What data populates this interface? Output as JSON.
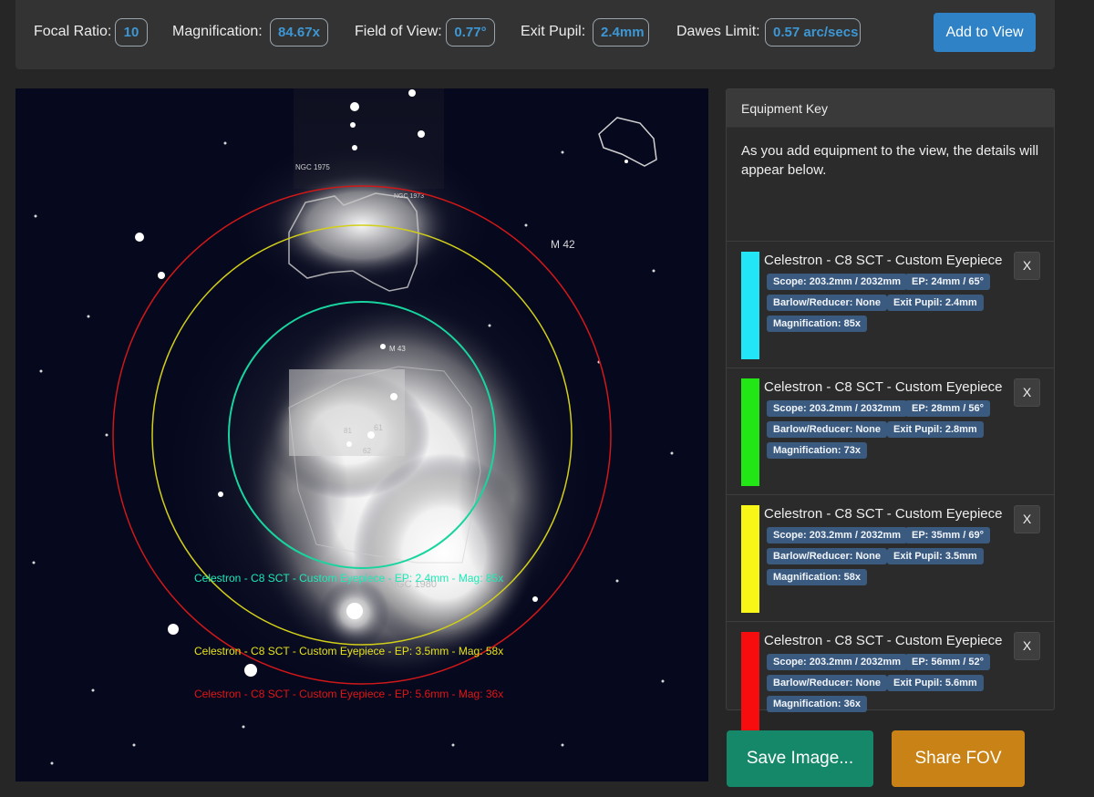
{
  "stats": [
    {
      "label": "Focal Ratio:",
      "value": "10"
    },
    {
      "label": "Magnification:",
      "value": "84.67x"
    },
    {
      "label": "Field of View:",
      "value": "0.77°"
    },
    {
      "label": "Exit Pupil:",
      "value": "2.4mm"
    },
    {
      "label": "Dawes Limit:",
      "value": "0.57 arc/secs"
    }
  ],
  "add_button": "Add to View",
  "sky": {
    "labels": {
      "ngc1975": "NGC 1975",
      "ngc1973": "NGC 1973",
      "m42": "M 42",
      "m43": "M 43",
      "ngc1980": "NGC 1980",
      "star61": "61",
      "star62": "62",
      "star81": "81"
    },
    "fov_captions": [
      {
        "text": "Celestron - C8 SCT - Custom Eyepiece - EP: 2.4mm - Mag: 85x",
        "color": "#1de9b6"
      },
      {
        "text": "Celestron - C8 SCT - Custom Eyepiece - EP: 3.5mm - Mag: 58x",
        "color": "#e6e21a"
      },
      {
        "text": "Celestron - C8 SCT - Custom Eyepiece - EP: 5.6mm - Mag: 36x",
        "color": "#e01515"
      }
    ]
  },
  "panel": {
    "title": "Equipment Key",
    "description": "As you add equipment to the view, the details will appear below.",
    "items": [
      {
        "color": "#22e6f7",
        "title": "Celestron - C8 SCT - Custom Eyepiece",
        "scope": "Scope: 203.2mm / 2032mm",
        "ep": "EP: 24mm / 65°",
        "barlow": "Barlow/Reducer: None",
        "exit_pupil": "Exit Pupil: 2.4mm",
        "magnification": "Magnification: 85x",
        "close": "X"
      },
      {
        "color": "#22e616",
        "title": "Celestron - C8 SCT - Custom Eyepiece",
        "scope": "Scope: 203.2mm / 2032mm",
        "ep": "EP: 28mm / 56°",
        "barlow": "Barlow/Reducer: None",
        "exit_pupil": "Exit Pupil: 2.8mm",
        "magnification": "Magnification: 73x",
        "close": "X"
      },
      {
        "color": "#f7f616",
        "title": "Celestron - C8 SCT - Custom Eyepiece",
        "scope": "Scope: 203.2mm / 2032mm",
        "ep": "EP: 35mm / 69°",
        "barlow": "Barlow/Reducer: None",
        "exit_pupil": "Exit Pupil: 3.5mm",
        "magnification": "Magnification: 58x",
        "close": "X"
      },
      {
        "color": "#f70d0d",
        "title": "Celestron - C8 SCT - Custom Eyepiece",
        "scope": "Scope: 203.2mm / 2032mm",
        "ep": "EP: 56mm / 52°",
        "barlow": "Barlow/Reducer: None",
        "exit_pupil": "Exit Pupil: 5.6mm",
        "magnification": "Magnification: 36x",
        "close": "X"
      }
    ]
  },
  "save_button": "Save Image...",
  "share_button": "Share FOV"
}
